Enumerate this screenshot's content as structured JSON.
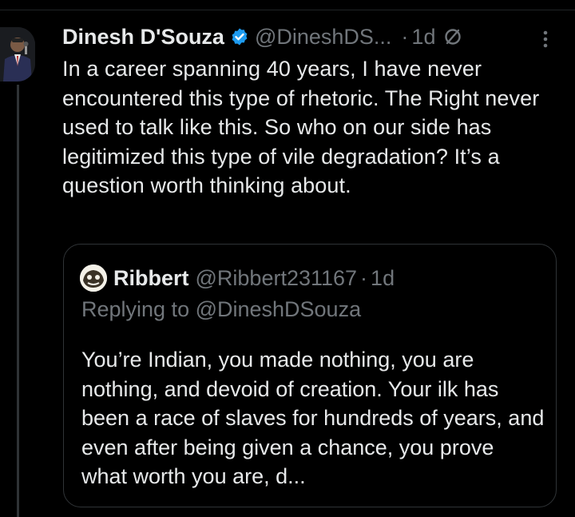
{
  "tweet": {
    "display_name": "Dinesh D'Souza",
    "handle": "@DineshDS...",
    "separator": "·",
    "time": "1d",
    "body": "In a career spanning 40 years, I have never encountered this type of rhetoric. The Right never used to talk like this. So who on our side has legitimized this type of vile degradation? It’s a question worth thinking about.",
    "icons": {
      "verified": "verified-badge-icon",
      "no_sign": "no-sign-icon",
      "more": "more-options-icon"
    }
  },
  "quote": {
    "display_name": "Ribbert",
    "handle": "@Ribbert231167",
    "separator": "·",
    "time": "1d",
    "replying_to": "Replying to @DineshDSouza",
    "body": "You’re Indian, you made nothing, you are nothing, and devoid of creation. Your ilk has been a race of slaves for hundreds of years, and even after being given a chance, you prove what worth you are, d..."
  },
  "colors": {
    "background": "#000000",
    "text_primary": "#e7e9ea",
    "text_secondary": "#71767b",
    "verified_blue": "#1d9bf0",
    "border": "#2f3336"
  }
}
